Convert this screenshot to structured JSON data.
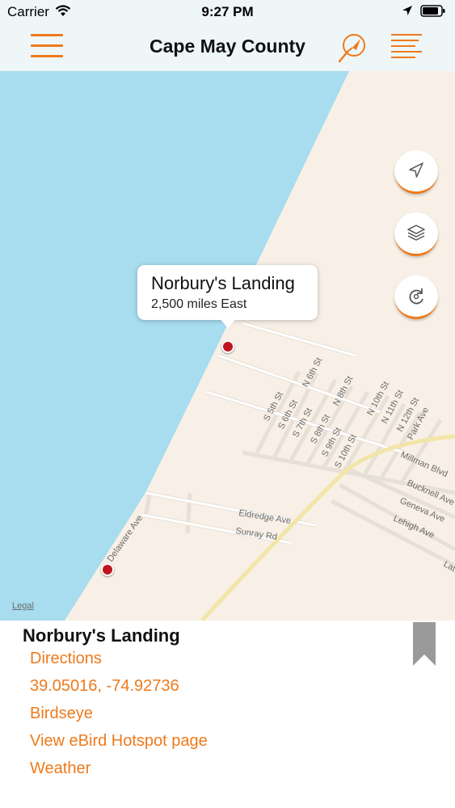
{
  "status_bar": {
    "carrier": "Carrier",
    "time": "9:27 PM"
  },
  "nav": {
    "title": "Cape May County"
  },
  "map": {
    "legal": "Legal",
    "water_color": "#a8dcef",
    "land_color": "#f8f0e6",
    "streets": [
      "N 6th St",
      "S 5th St",
      "S 6th St",
      "S 7th St",
      "S 8th St",
      "N 8th St",
      "S 9th St",
      "S 10th St",
      "N 10th St",
      "N 11th St",
      "N 12th St",
      "Park Ave",
      "Millman Blvd",
      "Bucknell Ave",
      "Geneva Ave",
      "Lehigh Ave",
      "Eldredge Ave",
      "Sunray Rd",
      "Delaware Ave",
      "Lat"
    ],
    "controls": [
      "location-icon",
      "layers-icon",
      "refresh-icon"
    ]
  },
  "callout": {
    "title": "Norbury's Landing",
    "subtitle": "2,500 miles East"
  },
  "panel": {
    "title": "Norbury's Landing",
    "links": [
      "Directions",
      "39.05016, -74.92736",
      "Birdseye",
      "View eBird Hotspot page",
      "Weather"
    ]
  },
  "colors": {
    "accent": "#ee7a1c",
    "pin": "#c0141f"
  }
}
